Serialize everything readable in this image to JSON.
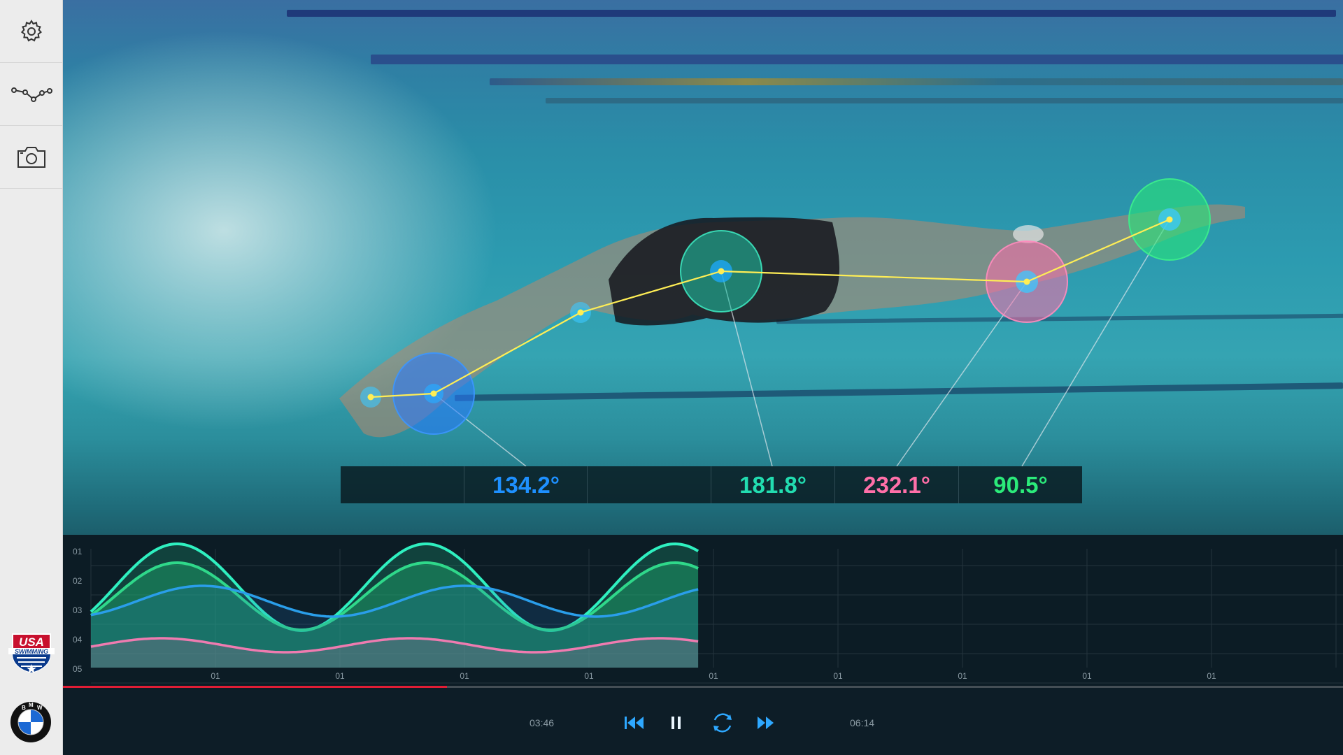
{
  "sidebar": {
    "items": [
      {
        "name": "settings",
        "icon": "gear-icon"
      },
      {
        "name": "graph",
        "icon": "node-graph-icon"
      },
      {
        "name": "camera",
        "icon": "camera-icon"
      }
    ],
    "logos": [
      {
        "name": "usa-swimming-logo",
        "text_top": "USA",
        "text_band": "SWIMMING"
      },
      {
        "name": "bmw-logo",
        "letters": "BMW"
      }
    ]
  },
  "angles": [
    {
      "value": "134.2°",
      "color": "#1e90ff"
    },
    {
      "value": "181.8°",
      "color": "#22dcb0"
    },
    {
      "value": "232.1°",
      "color": "#ff6fa8"
    },
    {
      "value": "90.5°",
      "color": "#2bea7a"
    }
  ],
  "chart_data": {
    "type": "area",
    "y_tick_labels": [
      "01",
      "02",
      "03",
      "04",
      "05"
    ],
    "x_tick_labels": [
      "01",
      "01",
      "01",
      "01",
      "01",
      "01",
      "01",
      "01",
      "01"
    ],
    "grid": true,
    "played_fraction": 0.485,
    "series": [
      {
        "color": "#2ff0c0"
      },
      {
        "color": "#2fd88a"
      },
      {
        "color": "#2a9eea"
      },
      {
        "color": "#ef7bb0"
      }
    ]
  },
  "player": {
    "elapsed": "03:46",
    "total": "06:14",
    "progress": 0.3,
    "buttons": [
      "skip-back-icon",
      "pause-icon",
      "replay-icon",
      "skip-forward-icon"
    ]
  }
}
